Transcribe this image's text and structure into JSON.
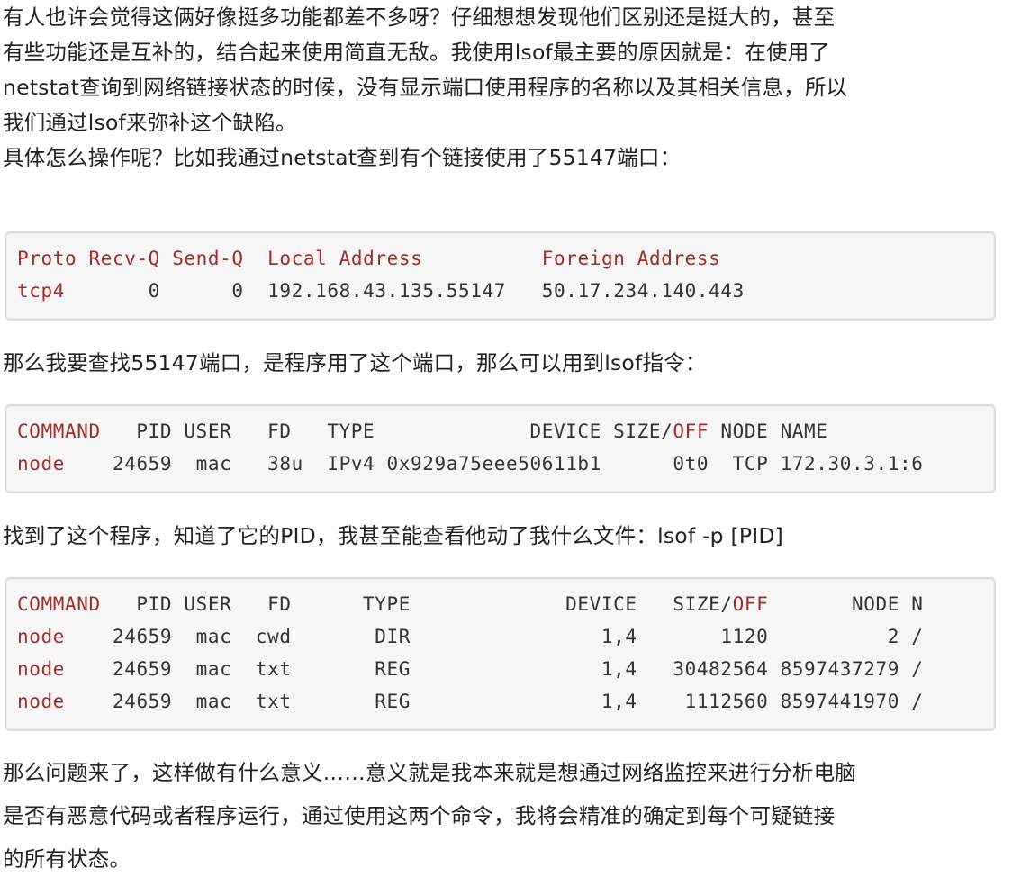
{
  "paragraphs": {
    "p1": [
      "有人也许会觉得这俩好像挺多功能都差不多呀？仔细想想发现他们区别还是挺大的，甚至",
      "有些功能还是互补的，结合起来使用简直无敌。我使用lsof最主要的原因就是：在使用了",
      "netstat查询到网络链接状态的时候，没有显示端口使用程序的名称以及其相关信息，所以",
      "我们通过lsof来弥补这个缺陷。",
      "具体怎么操作呢？比如我通过netstat查到有个链接使用了55147端口："
    ],
    "p2": "那么我要查找55147端口，是程序用了这个端口，那么可以用到lsof指令：",
    "p3": "找到了这个程序，知道了它的PID，我甚至能查看他动了我什么文件：lsof -p [PID]",
    "p4": [
      "那么问题来了，这样做有什么意义……意义就是我本来就是想通过网络监控来进行分析电脑",
      "是否有恶意代码或者程序运行，通过使用这两个命令，我将会精准的确定到每个可疑链接",
      "的所有状态。"
    ]
  },
  "code_blocks": {
    "netstat": {
      "header": {
        "proto": "Proto",
        "recvq": "Recv-Q",
        "sendq": "Send-Q",
        "local": "Local Address",
        "foreign": "Foreign Address"
      },
      "row": {
        "proto": "tcp4",
        "recvq": "0",
        "sendq": "0",
        "local": "192.168.43.135.55147",
        "foreign": "50.17.234.140.443"
      }
    },
    "lsof_port": {
      "header": {
        "command": "COMMAND",
        "rest_before_off": "   PID USER   FD   TYPE             DEVICE SIZE/",
        "off": "OFF",
        "rest_after_off": " NODE NAME"
      },
      "row": {
        "command": "node",
        "rest": "    24659  mac   38u  IPv4 0x929a75eee50611b1      0t0  TCP 172.30.3.1:6"
      }
    },
    "lsof_pid": {
      "header": {
        "command": "COMMAND",
        "rest_before_off": "   PID USER   FD      TYPE             DEVICE   SIZE/",
        "off": "OFF",
        "rest_after_off": "       NODE N"
      },
      "rows": [
        {
          "command": "node",
          "rest": "    24659  mac  cwd       DIR                1,4       1120          2 /"
        },
        {
          "command": "node",
          "rest": "    24659  mac  txt       REG                1,4   30482564 8597437279 /"
        },
        {
          "command": "node",
          "rest": "    24659  mac  txt       REG                1,4    1112560 8597441970 /"
        }
      ]
    }
  },
  "colors": {
    "keyword": "#a52a2a",
    "code_bg": "#f6f6f6",
    "code_border": "#dddddd",
    "text": "#222222"
  }
}
